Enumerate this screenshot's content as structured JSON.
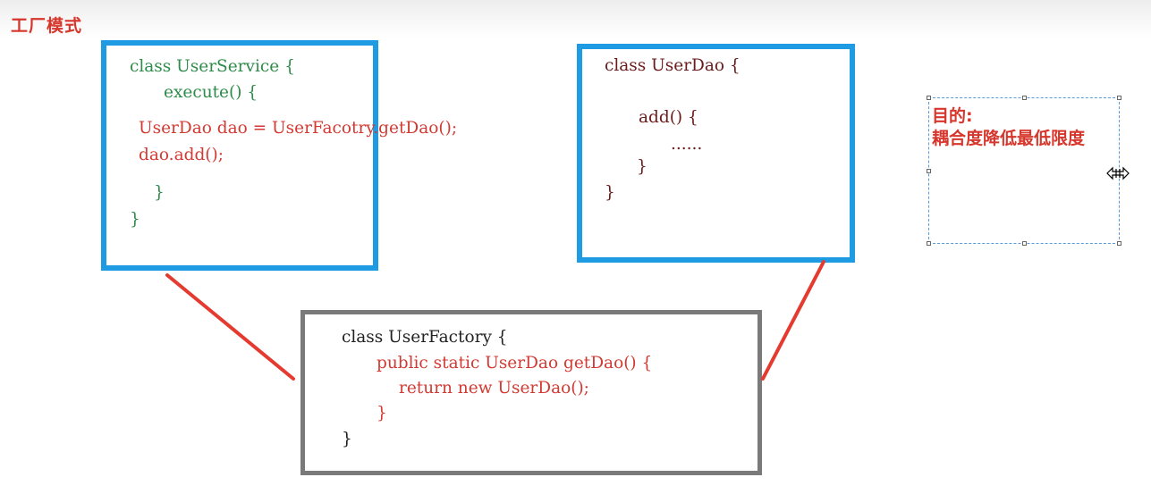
{
  "title": "工厂模式",
  "user_service": {
    "line1": "class UserService {",
    "line2": "execute() {",
    "line3": "UserDao dao = UserFacotry.getDao();",
    "line4": "dao.add();",
    "line5": "}",
    "line6": "}"
  },
  "user_dao": {
    "line1": "class UserDao {",
    "line2": "add() {",
    "line3": "......",
    "line4": "}",
    "line5": "}"
  },
  "user_factory": {
    "line1": "class UserFactory {",
    "line2": "public static UserDao getDao() {",
    "line3": "return new UserDao();",
    "line4": "}",
    "line5": "}"
  },
  "goal": {
    "label": "目的:",
    "text": "耦合度降低最低限度"
  },
  "colors": {
    "blue_border": "#1e9be3",
    "gray_border": "#7a7a7a",
    "red_accent": "#d23a33",
    "green_code": "#2e8b4a"
  }
}
